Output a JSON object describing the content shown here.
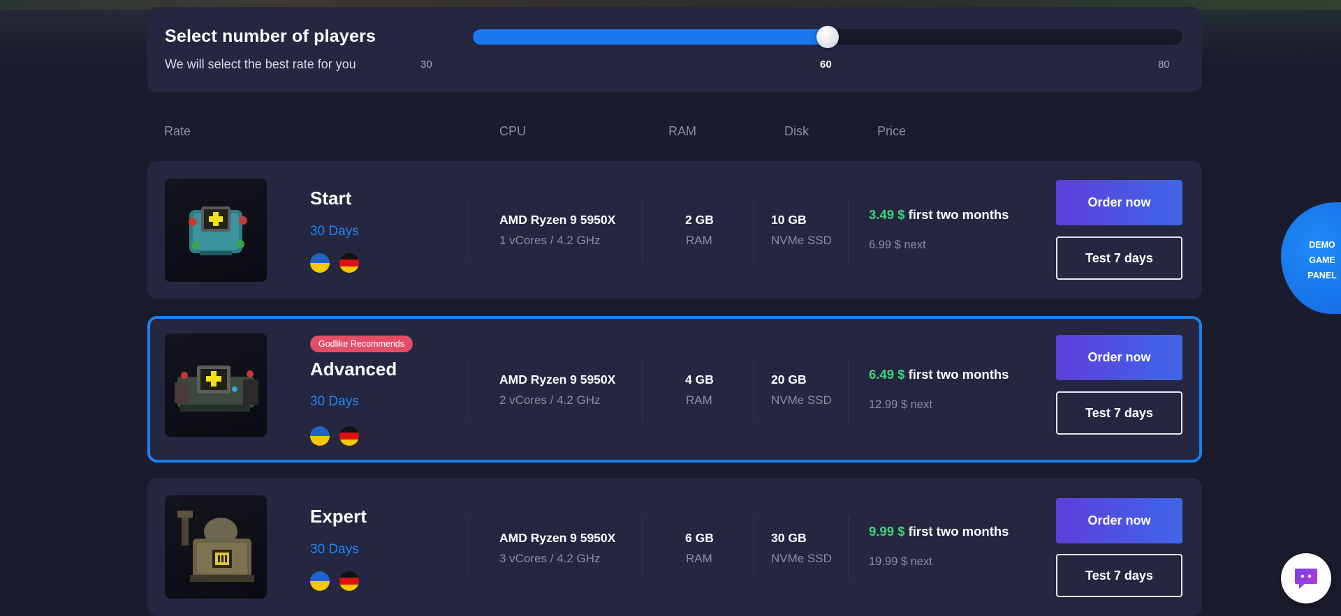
{
  "players": {
    "title": "Select number of players",
    "subtitle": "We will select the best rate for you",
    "min_label": "30",
    "current_label": "60",
    "max_label": "80",
    "slider_fraction": 0.5
  },
  "columns": {
    "rate": "Rate",
    "cpu": "CPU",
    "ram": "RAM",
    "disk": "Disk",
    "price": "Price"
  },
  "plans": [
    {
      "name": "Start",
      "period": "30 Days",
      "badge": "",
      "cpu": "AMD Ryzen 9 5950X",
      "cpu_detail": "1 vCores / 4.2 GHz",
      "ram": "2 GB",
      "ram_label": "RAM",
      "disk": "10 GB",
      "disk_type": "NVMe SSD",
      "price": "3.49 $",
      "price_note": "first two months",
      "next_price": "6.99 $ next",
      "order_label": "Order now",
      "test_label": "Test 7 days",
      "icon": "medkit-crate-icon"
    },
    {
      "name": "Advanced",
      "period": "30 Days",
      "badge": "Godlike Recommends",
      "cpu": "AMD Ryzen 9 5950X",
      "cpu_detail": "2 vCores / 4.2 GHz",
      "ram": "4 GB",
      "ram_label": "RAM",
      "disk": "20 GB",
      "disk_type": "NVMe SSD",
      "price": "6.49 $",
      "price_note": "first two months",
      "next_price": "12.99 $ next",
      "order_label": "Order now",
      "test_label": "Test 7 days",
      "icon": "medkit-machine-icon"
    },
    {
      "name": "Expert",
      "period": "30 Days",
      "badge": "",
      "cpu": "AMD Ryzen 9 5950X",
      "cpu_detail": "3 vCores / 4.2 GHz",
      "ram": "6 GB",
      "ram_label": "RAM",
      "disk": "30 GB",
      "disk_type": "NVMe SSD",
      "price": "9.99 $",
      "price_note": "first two months",
      "next_price": "19.99 $ next",
      "order_label": "Order now",
      "test_label": "Test 7 days",
      "icon": "generator-machine-icon"
    }
  ],
  "demo_panel": {
    "line1": "DEMO",
    "line2": "GAME",
    "line3": "PANEL"
  },
  "colors": {
    "accent_blue": "#1f86f5",
    "price_green": "#3ed57a",
    "badge_red": "#e34d68",
    "card_bg": "#252640",
    "page_bg": "#1b1b2e"
  },
  "chat": {
    "icon": "chat-bubble-icon"
  }
}
